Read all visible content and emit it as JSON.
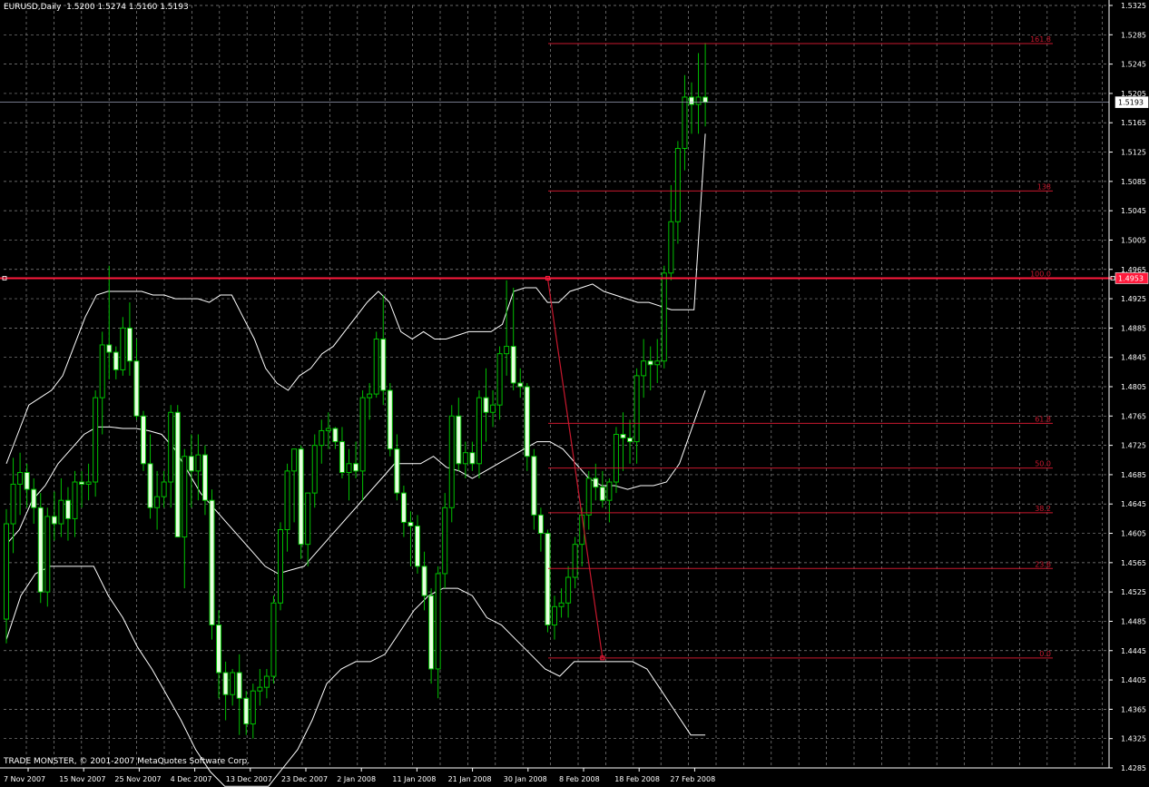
{
  "window": {
    "symbol_timeframe": "EURUSD,Daily",
    "ohlc": "1.5200 1.5274 1.5160 1.5193",
    "copyright": "TRADE MONSTER, © 2001-2007 MetaQuotes Software Corp."
  },
  "colors": {
    "background": "#000000",
    "grid": "#8a8a8a",
    "bull_candle": "#00c000",
    "bear_candle_fill": "#e8ffe0",
    "bands": "#ffffff",
    "fib": "#c8182e",
    "hline": "#ff1a3c",
    "axis_text": "#ffffff"
  },
  "chart_data": {
    "type": "candlestick",
    "price_scale": {
      "min": 1.4285,
      "max": 1.5325,
      "tick_labels": [
        "1.5325",
        "1.5285",
        "1.5245",
        "1.5205",
        "1.5165",
        "1.5125",
        "1.5085",
        "1.5045",
        "1.5005",
        "1.4965",
        "1.4925",
        "1.4885",
        "1.4845",
        "1.4805",
        "1.4765",
        "1.4725",
        "1.4685",
        "1.4645",
        "1.4605",
        "1.4565",
        "1.4525",
        "1.4485",
        "1.4445",
        "1.4405",
        "1.4365",
        "1.4325",
        "1.4285"
      ]
    },
    "time_scale": {
      "labels": [
        "7 Nov 2007",
        "15 Nov 2007",
        "25 Nov 2007",
        "4 Dec 2007",
        "13 Dec 2007",
        "23 Dec 2007",
        "2 Jan 2008",
        "11 Jan 2008",
        "21 Jan 2008",
        "30 Jan 2008",
        "8 Feb 2008",
        "18 Feb 2008",
        "27 Feb 2008"
      ]
    },
    "current_price": "1.5193",
    "horizontal_line_price": "1.4953",
    "fibonacci": {
      "high": 1.4953,
      "low": 1.4435,
      "levels": [
        {
          "label": "161.8",
          "price": 1.5273
        },
        {
          "label": "138",
          "price": 1.5072
        },
        {
          "label": "100.0",
          "price": 1.4953
        },
        {
          "label": "61.8",
          "price": 1.4755
        },
        {
          "label": "50.0",
          "price": 1.4694
        },
        {
          "label": "38.2",
          "price": 1.4633
        },
        {
          "label": "23.6",
          "price": 1.4557
        },
        {
          "label": "0.0",
          "price": 1.4435
        }
      ]
    },
    "candles": [
      [
        1.4488,
        1.4638,
        1.4455,
        1.4618
      ],
      [
        1.4618,
        1.4708,
        1.4578,
        1.4672
      ],
      [
        1.4672,
        1.4715,
        1.463,
        1.4688
      ],
      [
        1.4688,
        1.47,
        1.464,
        1.4665
      ],
      [
        1.4665,
        1.468,
        1.4618,
        1.464
      ],
      [
        1.464,
        1.466,
        1.451,
        1.4525
      ],
      [
        1.4525,
        1.464,
        1.4505,
        1.4628
      ],
      [
        1.4628,
        1.4662,
        1.4595,
        1.4618
      ],
      [
        1.4618,
        1.468,
        1.46,
        1.465
      ],
      [
        1.465,
        1.4668,
        1.4595,
        1.4625
      ],
      [
        1.4625,
        1.469,
        1.46,
        1.4675
      ],
      [
        1.4675,
        1.469,
        1.464,
        1.4672
      ],
      [
        1.4672,
        1.47,
        1.465,
        1.4675
      ],
      [
        1.4675,
        1.48,
        1.4655,
        1.479
      ],
      [
        1.479,
        1.488,
        1.474,
        1.4862
      ],
      [
        1.4862,
        1.497,
        1.4815,
        1.4852
      ],
      [
        1.4852,
        1.486,
        1.4815,
        1.4828
      ],
      [
        1.4828,
        1.49,
        1.482,
        1.4885
      ],
      [
        1.4885,
        1.492,
        1.482,
        1.484
      ],
      [
        1.484,
        1.487,
        1.476,
        1.4765
      ],
      [
        1.4765,
        1.4772,
        1.469,
        1.47
      ],
      [
        1.47,
        1.474,
        1.4625,
        1.464
      ],
      [
        1.464,
        1.469,
        1.461,
        1.4655
      ],
      [
        1.4655,
        1.469,
        1.464,
        1.4675
      ],
      [
        1.4675,
        1.478,
        1.464,
        1.477
      ],
      [
        1.477,
        1.478,
        1.465,
        1.46
      ],
      [
        1.46,
        1.472,
        1.453,
        1.471
      ],
      [
        1.471,
        1.474,
        1.464,
        1.469
      ],
      [
        1.469,
        1.474,
        1.465,
        1.4712
      ],
      [
        1.4712,
        1.4725,
        1.463,
        1.465
      ],
      [
        1.465,
        1.4665,
        1.446,
        1.448
      ],
      [
        1.448,
        1.45,
        1.438,
        1.4415
      ],
      [
        1.4415,
        1.443,
        1.435,
        1.4385
      ],
      [
        1.4385,
        1.442,
        1.437,
        1.4415
      ],
      [
        1.4415,
        1.444,
        1.433,
        1.438
      ],
      [
        1.438,
        1.439,
        1.433,
        1.4345
      ],
      [
        1.4345,
        1.44,
        1.4325,
        1.439
      ],
      [
        1.439,
        1.442,
        1.437,
        1.4395
      ],
      [
        1.4395,
        1.442,
        1.438,
        1.441
      ],
      [
        1.441,
        1.452,
        1.44,
        1.451
      ],
      [
        1.451,
        1.462,
        1.45,
        1.461
      ],
      [
        1.461,
        1.47,
        1.458,
        1.469
      ],
      [
        1.469,
        1.472,
        1.462,
        1.472
      ],
      [
        1.472,
        1.4725,
        1.457,
        1.459
      ],
      [
        1.459,
        1.466,
        1.456,
        1.466
      ],
      [
        1.466,
        1.474,
        1.464,
        1.4725
      ],
      [
        1.4725,
        1.476,
        1.47,
        1.4745
      ],
      [
        1.4745,
        1.477,
        1.472,
        1.4748
      ],
      [
        1.4748,
        1.475,
        1.472,
        1.473
      ],
      [
        1.473,
        1.475,
        1.468,
        1.4688
      ],
      [
        1.4688,
        1.472,
        1.465,
        1.47
      ],
      [
        1.47,
        1.473,
        1.468,
        1.469
      ],
      [
        1.469,
        1.48,
        1.465,
        1.479
      ],
      [
        1.479,
        1.481,
        1.476,
        1.4795
      ],
      [
        1.4795,
        1.488,
        1.479,
        1.487
      ],
      [
        1.487,
        1.493,
        1.478,
        1.48
      ],
      [
        1.48,
        1.481,
        1.471,
        1.472
      ],
      [
        1.472,
        1.474,
        1.465,
        1.466
      ],
      [
        1.466,
        1.467,
        1.46,
        1.462
      ],
      [
        1.462,
        1.4635,
        1.456,
        1.4615
      ],
      [
        1.4615,
        1.463,
        1.455,
        1.456
      ],
      [
        1.456,
        1.458,
        1.45,
        1.452
      ],
      [
        1.452,
        1.453,
        1.44,
        1.442
      ],
      [
        1.442,
        1.456,
        1.438,
        1.455
      ],
      [
        1.455,
        1.466,
        1.453,
        1.464
      ],
      [
        1.464,
        1.478,
        1.462,
        1.4765
      ],
      [
        1.4765,
        1.479,
        1.469,
        1.47
      ],
      [
        1.47,
        1.473,
        1.468,
        1.4715
      ],
      [
        1.4715,
        1.473,
        1.469,
        1.47
      ],
      [
        1.47,
        1.48,
        1.468,
        1.479
      ],
      [
        1.479,
        1.483,
        1.473,
        1.477
      ],
      [
        1.477,
        1.48,
        1.475,
        1.478
      ],
      [
        1.478,
        1.486,
        1.476,
        1.485
      ],
      [
        1.485,
        1.495,
        1.482,
        1.486
      ],
      [
        1.486,
        1.494,
        1.48,
        1.481
      ],
      [
        1.481,
        1.483,
        1.479,
        1.4805
      ],
      [
        1.4805,
        1.481,
        1.469,
        1.471
      ],
      [
        1.471,
        1.472,
        1.461,
        1.463
      ],
      [
        1.463,
        1.464,
        1.458,
        1.4605
      ],
      [
        1.4605,
        1.461,
        1.447,
        1.448
      ],
      [
        1.448,
        1.452,
        1.446,
        1.4505
      ],
      [
        1.4505,
        1.453,
        1.449,
        1.451
      ],
      [
        1.451,
        1.456,
        1.449,
        1.4545
      ],
      [
        1.4545,
        1.46,
        1.453,
        1.459
      ],
      [
        1.459,
        1.464,
        1.456,
        1.463
      ],
      [
        1.463,
        1.469,
        1.461,
        1.468
      ],
      [
        1.468,
        1.47,
        1.465,
        1.4668
      ],
      [
        1.4668,
        1.469,
        1.464,
        1.465
      ],
      [
        1.465,
        1.468,
        1.462,
        1.4675
      ],
      [
        1.4675,
        1.475,
        1.466,
        1.474
      ],
      [
        1.474,
        1.477,
        1.469,
        1.4735
      ],
      [
        1.4735,
        1.476,
        1.47,
        1.473
      ],
      [
        1.473,
        1.483,
        1.47,
        1.482
      ],
      [
        1.482,
        1.487,
        1.479,
        1.484
      ],
      [
        1.484,
        1.486,
        1.48,
        1.4835
      ],
      [
        1.4835,
        1.487,
        1.481,
        1.484
      ],
      [
        1.484,
        1.497,
        1.483,
        1.496
      ],
      [
        1.496,
        1.508,
        1.495,
        1.503
      ],
      [
        1.503,
        1.514,
        1.5,
        1.513
      ],
      [
        1.513,
        1.523,
        1.51,
        1.52
      ],
      [
        1.52,
        1.522,
        1.515,
        1.519
      ],
      [
        1.519,
        1.526,
        1.515,
        1.52
      ],
      [
        1.52,
        1.5274,
        1.516,
        1.5193
      ]
    ],
    "bands": {
      "upper": [
        1.47,
        1.474,
        1.478,
        1.479,
        1.48,
        1.482,
        1.486,
        1.49,
        1.493,
        1.4935,
        1.4935,
        1.4935,
        1.4935,
        1.493,
        1.493,
        1.4925,
        1.4925,
        1.4925,
        1.492,
        1.493,
        1.493,
        1.49,
        1.487,
        1.483,
        1.481,
        1.48,
        1.482,
        1.483,
        1.485,
        1.486,
        1.488,
        1.49,
        1.492,
        1.4935,
        1.492,
        1.488,
        1.487,
        1.488,
        1.487,
        1.487,
        1.4875,
        1.488,
        1.488,
        1.488,
        1.489,
        1.4935,
        1.494,
        1.494,
        1.492,
        1.492,
        1.4935,
        1.494,
        1.4945,
        1.4935,
        1.493,
        1.4925,
        1.492,
        1.492,
        1.4915,
        1.491,
        1.491,
        1.491,
        1.515
      ],
      "middle": [
        1.459,
        1.461,
        1.465,
        1.467,
        1.47,
        1.472,
        1.474,
        1.475,
        1.475,
        1.4748,
        1.4748,
        1.4745,
        1.474,
        1.472,
        1.469,
        1.466,
        1.464,
        1.462,
        1.46,
        1.458,
        1.456,
        1.455,
        1.4555,
        1.456,
        1.458,
        1.46,
        1.462,
        1.464,
        1.466,
        1.468,
        1.47,
        1.47,
        1.47,
        1.471,
        1.4695,
        1.469,
        1.468,
        1.469,
        1.47,
        1.471,
        1.472,
        1.473,
        1.473,
        1.472,
        1.47,
        1.468,
        1.467,
        1.467,
        1.4665,
        1.467,
        1.467,
        1.4675,
        1.47,
        1.475,
        1.48
      ],
      "lower": [
        1.446,
        1.452,
        1.455,
        1.456,
        1.456,
        1.456,
        1.456,
        1.452,
        1.449,
        1.445,
        1.442,
        1.4385,
        1.435,
        1.431,
        1.428,
        1.426,
        1.426,
        1.426,
        1.426,
        1.4285,
        1.431,
        1.435,
        1.44,
        1.442,
        1.443,
        1.443,
        1.444,
        1.447,
        1.45,
        1.452,
        1.453,
        1.453,
        1.452,
        1.449,
        1.448,
        1.446,
        1.444,
        1.442,
        1.441,
        1.443,
        1.443,
        1.443,
        1.443,
        1.443,
        1.442,
        1.439,
        1.436,
        1.433,
        1.433
      ]
    }
  }
}
